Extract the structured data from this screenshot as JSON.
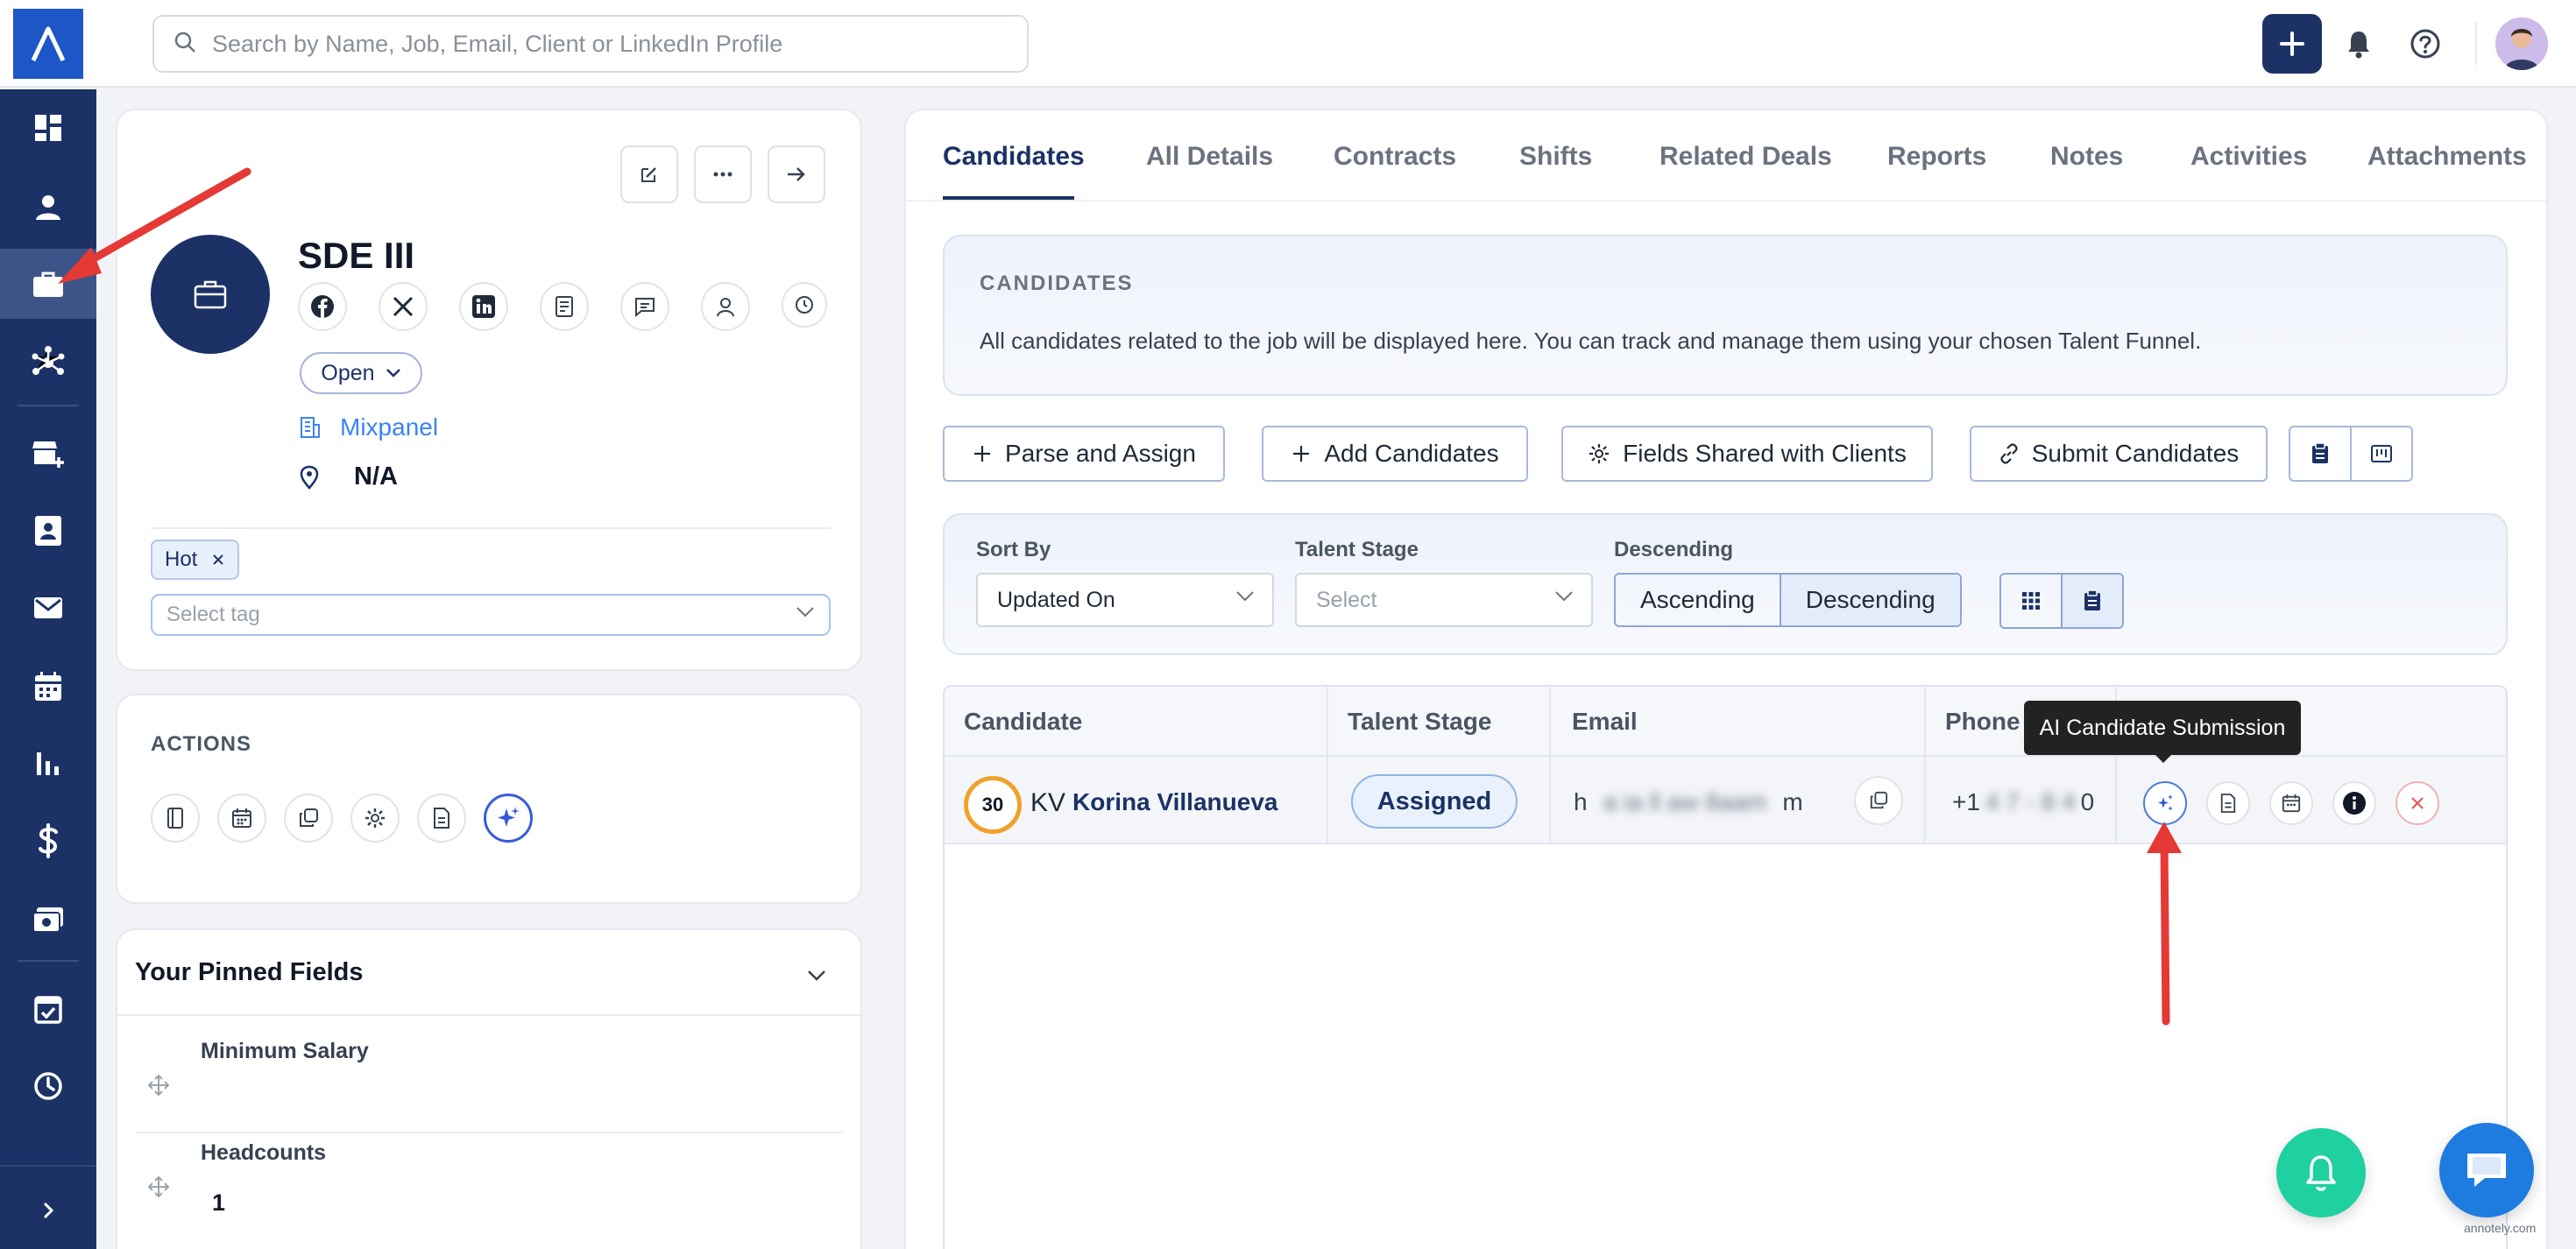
{
  "topbar": {
    "search_placeholder": "Search by Name, Job, Email, Client or LinkedIn Profile",
    "icons": [
      "logo-icon",
      "search-icon",
      "plus-icon",
      "bell-icon",
      "help-icon",
      "avatar"
    ]
  },
  "sidebar": {
    "items": [
      "dashboard-icon",
      "user-icon",
      "briefcase-icon",
      "network-icon",
      "store-add-icon",
      "contacts-icon",
      "mail-icon",
      "calendar-icon",
      "chart-icon",
      "dollar-icon",
      "cash-icon",
      "calendar-check-icon",
      "clock-icon",
      "expand-icon"
    ],
    "active": "briefcase-icon"
  },
  "job": {
    "title": "SDE III",
    "status": "Open",
    "client": "Mixpanel",
    "location": "N/A",
    "tag": "Hot",
    "tag_placeholder": "Select tag"
  },
  "actions": {
    "title": "ACTIONS"
  },
  "pinned": {
    "title": "Your Pinned Fields",
    "fields": [
      {
        "label": "Minimum Salary",
        "value": ""
      },
      {
        "label": "Headcounts",
        "value": "1"
      }
    ]
  },
  "tabs": [
    "Candidates",
    "All Details",
    "Contracts",
    "Shifts",
    "Related Deals",
    "Reports",
    "Notes",
    "Activities",
    "Attachments"
  ],
  "active_tab": "Candidates",
  "info": {
    "title": "CANDIDATES",
    "text": "All candidates related to the job will be displayed here. You can track and manage them using your chosen Talent Funnel."
  },
  "buttons": {
    "parse_assign": "Parse and Assign",
    "add_candidates": "Add Candidates",
    "fields_shared": "Fields Shared with Clients",
    "submit_candidates": "Submit Candidates"
  },
  "filters": {
    "sort_by_label": "Sort By",
    "sort_by_value": "Updated On",
    "talent_stage_label": "Talent Stage",
    "talent_stage_placeholder": "Select",
    "order_label": "Descending",
    "ascending": "Ascending",
    "descending": "Descending"
  },
  "table": {
    "headers": [
      "Candidate",
      "Talent Stage",
      "Email",
      "Phone"
    ],
    "rows": [
      {
        "score": "30",
        "initials": "KV",
        "name": "Korina Villanueva",
        "stage": "Assigned",
        "email_start": "h",
        "email_blur": "a ia ll aw 8aam",
        "email_end": "m",
        "phone_start": "+1",
        "phone_blur": "4 7 - 8 4",
        "phone_end": "0"
      }
    ]
  },
  "tooltip": "AI Candidate Submission",
  "watermark": "annotely.com",
  "colors": {
    "primary": "#1c3266",
    "accent": "#1e56c8",
    "score_ring": "#f0a12a",
    "annotation": "#e53935",
    "bell_fab": "#1fd0a0",
    "chat_fab": "#1e7be0"
  }
}
